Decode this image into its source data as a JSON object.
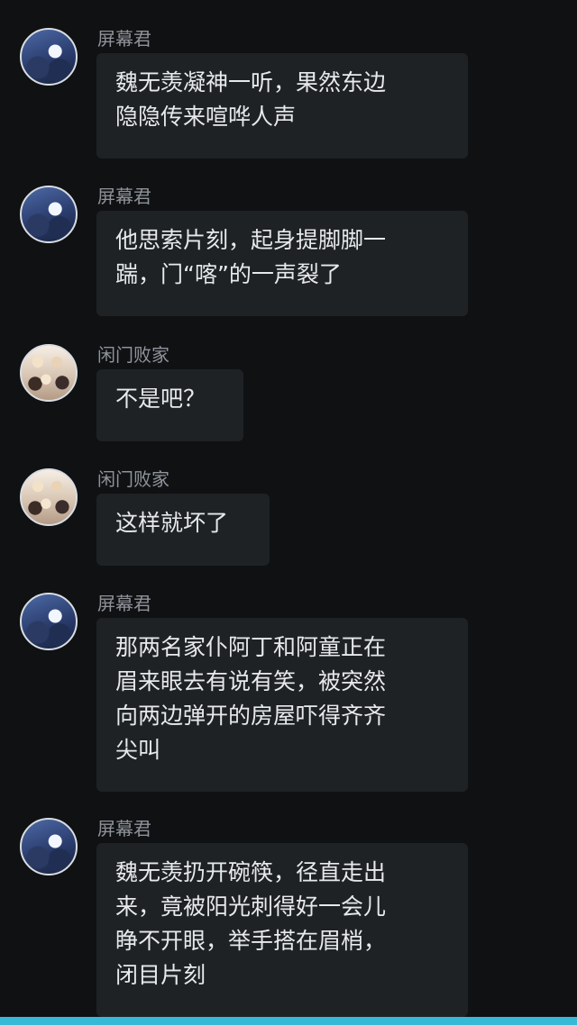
{
  "colors": {
    "background": "#0f1113",
    "bubble": "#1f2225",
    "bubble_text": "#e7e9ec",
    "name_text": "#8f9399",
    "bottom_bar": "#36b9d6"
  },
  "messages": [
    {
      "name": "屏幕君",
      "text": "魏无羡凝神一听，果然东边\n隐隐传来喧哗人声",
      "avatar": "blue-avatar"
    },
    {
      "name": "屏幕君",
      "text": "他思索片刻，起身提脚脚一\n踹，门“喀”的一声裂了",
      "avatar": "blue-avatar"
    },
    {
      "name": "闲门败家",
      "text": "不是吧？",
      "avatar": "warm-avatar"
    },
    {
      "name": "闲门败家",
      "text": "这样就坏了",
      "avatar": "warm-avatar"
    },
    {
      "name": "屏幕君",
      "text": "那两名家仆阿丁和阿童正在\n眉来眼去有说有笑，被突然\n向两边弹开的房屋吓得齐齐\n尖叫",
      "avatar": "blue-avatar"
    },
    {
      "name": "屏幕君",
      "text": "魏无羡扔开碗筷，径直走出\n来，竟被阳光刺得好一会儿\n睁不开眼，举手搭在眉梢，\n闭目片刻",
      "avatar": "blue-avatar"
    }
  ]
}
